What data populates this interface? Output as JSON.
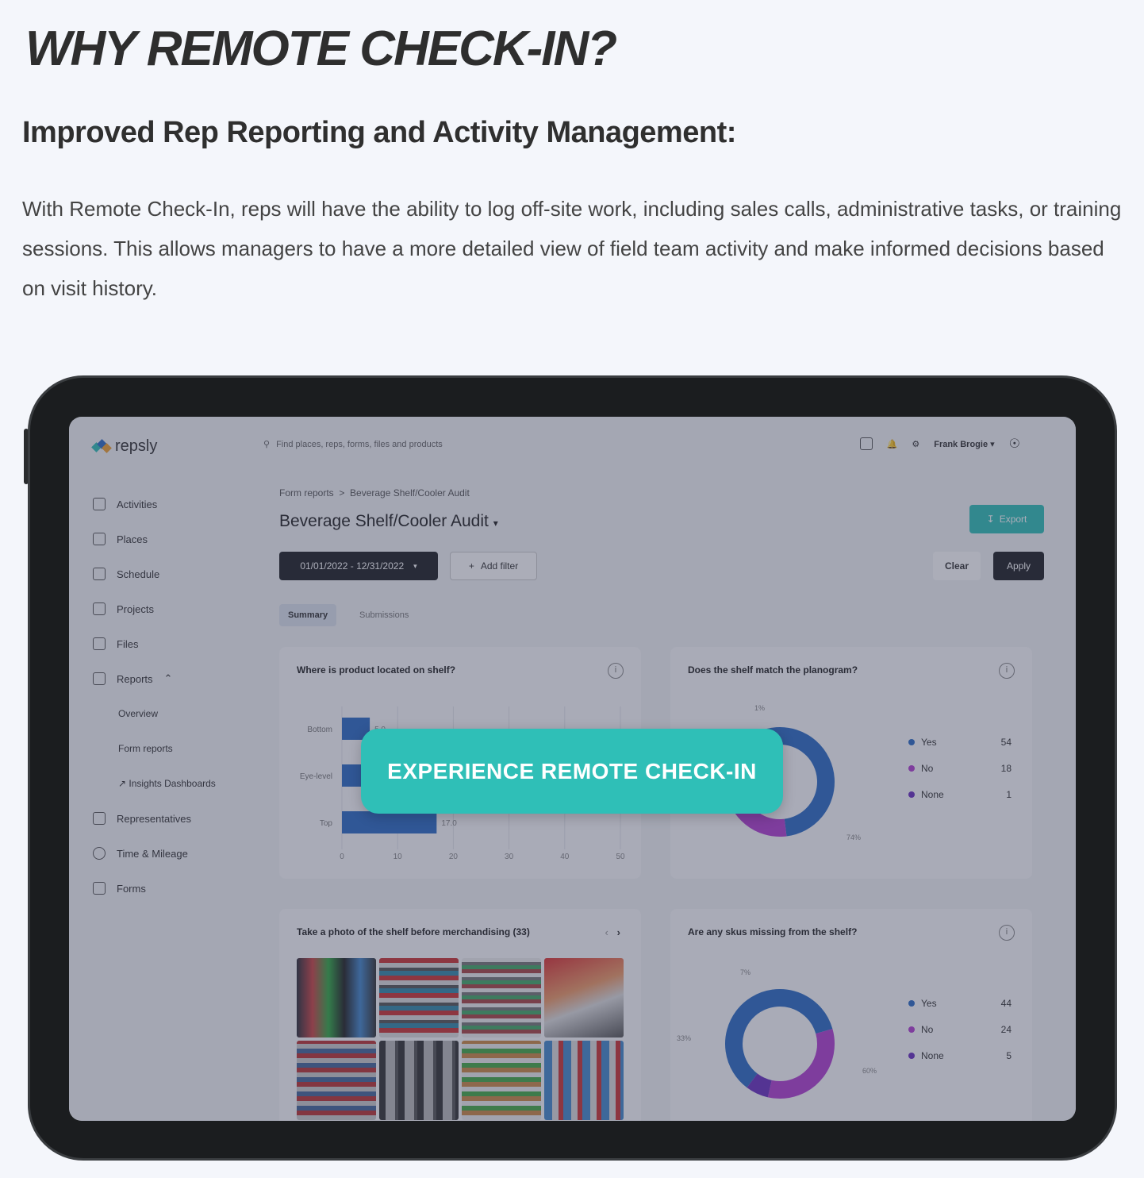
{
  "heading": "WHY REMOTE CHECK-IN?",
  "subheading": "Improved Rep Reporting and Activity Management:",
  "paragraph": "With Remote Check-In, reps will have the ability to log off-site work, including sales calls, administrative tasks, or training sessions. This allows managers to have a more detailed view of field team activity and make informed decisions based on visit history.",
  "cta": "EXPERIENCE REMOTE CHECK-IN",
  "app": {
    "logo": "repsly",
    "search_placeholder": "Find places, reps, forms, files and products",
    "user": "Frank Brogie",
    "nav": [
      {
        "label": "Activities"
      },
      {
        "label": "Places"
      },
      {
        "label": "Schedule"
      },
      {
        "label": "Projects"
      },
      {
        "label": "Files"
      },
      {
        "label": "Reports"
      }
    ],
    "reports_sub": [
      "Overview",
      "Form reports",
      "Insights Dashboards"
    ],
    "nav_bottom": [
      {
        "label": "Representatives"
      },
      {
        "label": "Time & Mileage"
      },
      {
        "label": "Forms"
      }
    ],
    "breadcrumb": [
      "Form reports",
      "Beverage Shelf/Cooler Audit"
    ],
    "title": "Beverage Shelf/Cooler Audit",
    "export": "Export",
    "date_range": "01/01/2022 - 12/31/2022",
    "add_filter": "Add filter",
    "clear": "Clear",
    "apply": "Apply",
    "tabs": [
      "Summary",
      "Submissions"
    ],
    "colors": {
      "accent": "#2fbfb7",
      "yes": "#2b6cc4",
      "no": "#b23fd0",
      "none": "#6a2fc0"
    }
  },
  "chart_data": [
    {
      "type": "bar",
      "title": "Where is product located on shelf?",
      "orientation": "horizontal",
      "categories": [
        "Bottom",
        "Eye-level",
        "Top"
      ],
      "values": [
        5.0,
        null,
        17.0
      ],
      "value_labels": [
        "5.0",
        "",
        "17.0"
      ],
      "xlim": [
        0,
        50
      ],
      "xticks": [
        "0",
        "10",
        "20",
        "30",
        "40",
        "50"
      ],
      "grid": true
    },
    {
      "type": "pie",
      "title": "Does the shelf match the planogram?",
      "donut": true,
      "series": [
        {
          "name": "Yes",
          "value": 54
        },
        {
          "name": "No",
          "value": 18
        },
        {
          "name": "None",
          "value": 1
        }
      ],
      "labels": [
        "74%",
        "",
        "1%"
      ]
    },
    {
      "type": "pie",
      "title": "Are any skus missing from the shelf?",
      "donut": true,
      "series": [
        {
          "name": "Yes",
          "value": 44
        },
        {
          "name": "No",
          "value": 24
        },
        {
          "name": "None",
          "value": 5
        }
      ],
      "labels": [
        "60%",
        "33%",
        "7%"
      ]
    }
  ],
  "photo_card_title": "Take a photo of the shelf before merchandising (33)"
}
